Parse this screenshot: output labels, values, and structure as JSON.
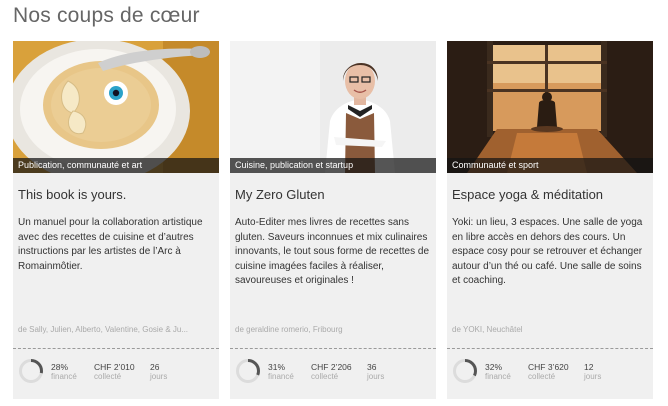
{
  "section": {
    "title": "Nos coups de cœur"
  },
  "cards": [
    {
      "tag": "Publication, communauté et art",
      "title": "This book is yours.",
      "description": "Un manuel pour la collaboration artistique avec des recettes de cuisine et d’autres instructions par les artistes de l’Arc à Romainmôtier.",
      "authors": "de Sally, Julien, Alberto, Valentine, Gosie & Ju...",
      "funded_pct": "28%",
      "funded_fraction": 0.28,
      "funded_label": "financé",
      "collected": "CHF 2’010",
      "collected_label": "collecté",
      "days": "26",
      "days_label": "jours"
    },
    {
      "tag": "Cuisine, publication et startup",
      "title": "My Zero Gluten",
      "description": "Auto-Editer mes livres de recettes sans gluten. Saveurs inconnues et mix culinaires innovants, le tout sous forme de recettes de cuisine imagées faciles à réaliser, savoureuses et originales !",
      "authors": "de geraldine romerio, Fribourg",
      "funded_pct": "31%",
      "funded_fraction": 0.31,
      "funded_label": "financé",
      "collected": "CHF 2’206",
      "collected_label": "collecté",
      "days": "36",
      "days_label": "jours"
    },
    {
      "tag": "Communauté et sport",
      "title": "Espace yoga & méditation",
      "description": "Yoki: un lieu, 3 espaces. Une salle de yoga en libre accès en dehors des cours. Un espace cosy pour se retrouver et échanger autour d’un thé ou café. Une salle de soins et coaching.",
      "authors": "de YOKI, Neuchâtel",
      "funded_pct": "32%",
      "funded_fraction": 0.32,
      "funded_label": "financé",
      "collected": "CHF 3’620",
      "collected_label": "collecté",
      "days": "12",
      "days_label": "jours"
    }
  ],
  "colors": {
    "gauge_fill": "#555555",
    "gauge_track": "#dcdcdc",
    "card_bg": "#f0f0f0"
  }
}
